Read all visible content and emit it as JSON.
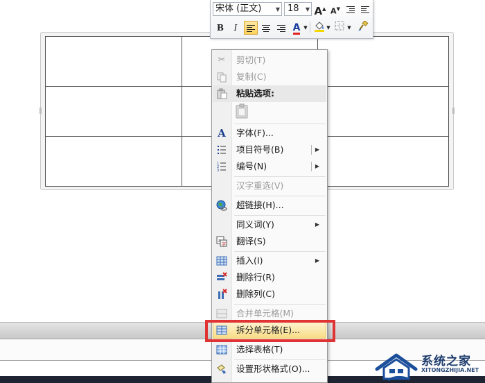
{
  "mini_toolbar": {
    "font_name": "宋体 (正文)",
    "font_size": "18",
    "grow_font_label": "A",
    "shrink_font_label": "A",
    "bold_label": "B",
    "italic_label": "I",
    "font_color_label": "A",
    "font_color_hex": "#e02020",
    "highlight_hex": "#f5d600"
  },
  "context_menu": {
    "cut": "剪切(T)",
    "copy": "复制(C)",
    "paste_options": "粘贴选项:",
    "font": "字体(F)...",
    "bullets": "项目符号(B)",
    "numbering": "编号(N)",
    "reconvert": "汉字重选(V)",
    "hyperlink": "超链接(H)...",
    "synonyms": "同义词(Y)",
    "translate": "翻译(S)",
    "insert": "插入(I)",
    "delete_rows": "删除行(R)",
    "delete_columns": "删除列(C)",
    "merge_cells": "合并单元格(M)",
    "split_cells": "拆分单元格(E)...",
    "select_table": "选择表格(T)",
    "format_shape": "设置形状格式(O)..."
  },
  "highlight_box_color": "#e03434",
  "watermark": {
    "title": "系统之家",
    "url": "XITONGZHIJIA.NET"
  }
}
